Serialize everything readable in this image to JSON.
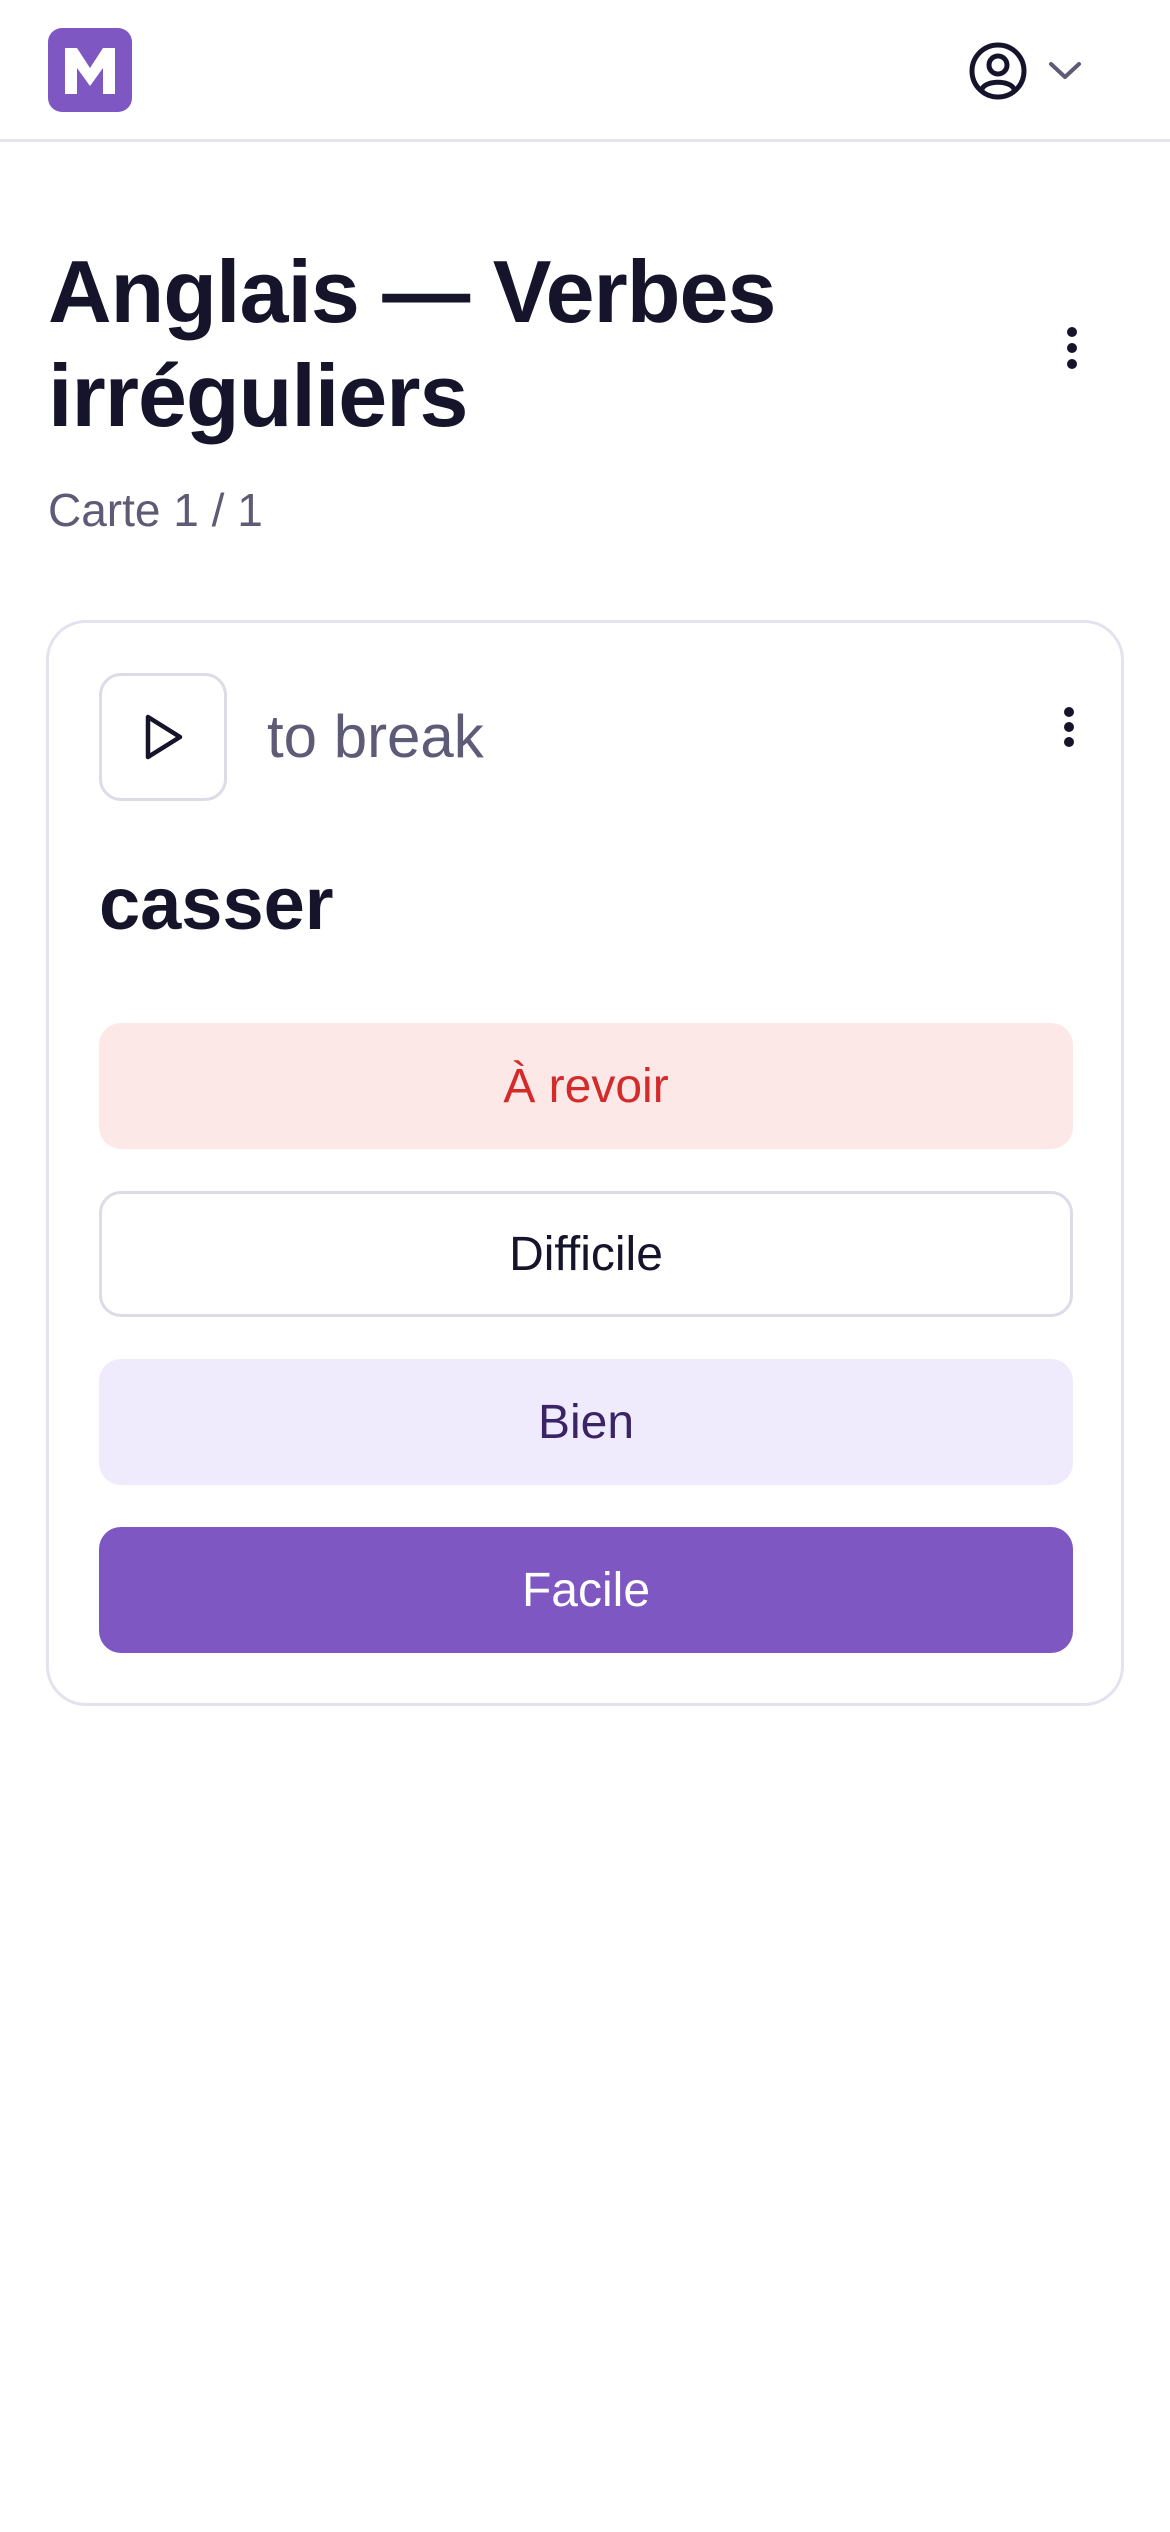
{
  "header": {
    "logo_letter": "M",
    "account_icon": "user-circle-icon",
    "account_dropdown_icon": "chevron-down-icon"
  },
  "page": {
    "title": "Anglais — Verbes irréguliers",
    "subtitle": "Carte 1 / 1",
    "menu_icon": "more-vertical-icon"
  },
  "card": {
    "play_icon": "play-icon",
    "front": "to break",
    "back": "casser",
    "menu_icon": "more-vertical-icon"
  },
  "answers": {
    "again": "À revoir",
    "hard": "Difficile",
    "good": "Bien",
    "easy": "Facile"
  },
  "colors": {
    "brand": "#7e57c2",
    "again_text": "#d42a2a",
    "again_bg": "#fde8e8",
    "good_bg": "#efebfd",
    "text": "#16142b",
    "muted": "#5e5b76"
  }
}
